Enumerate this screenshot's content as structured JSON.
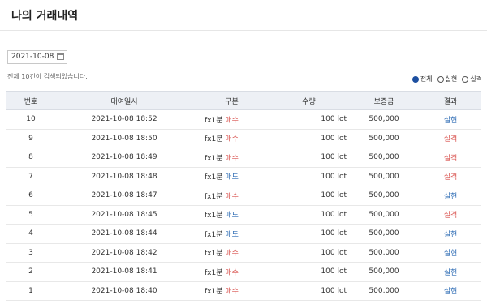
{
  "page": {
    "title": "나의 거래내역"
  },
  "search": {
    "date": "2021-10-08",
    "result_text": "전체 10건이 검색되었습니다."
  },
  "filters": [
    {
      "label": "전체",
      "selected": true
    },
    {
      "label": "실현",
      "selected": false
    },
    {
      "label": "실격",
      "selected": false
    }
  ],
  "table": {
    "headers": [
      "번호",
      "대여일시",
      "구분",
      "수량",
      "보증금",
      "결과"
    ],
    "rows": [
      {
        "no": "10",
        "datetime": "2021-10-08 18:52",
        "product": "fx1분",
        "side": "매수",
        "qty": "100 lot",
        "deposit": "500,000",
        "result": "실현"
      },
      {
        "no": "9",
        "datetime": "2021-10-08 18:50",
        "product": "fx1분",
        "side": "매수",
        "qty": "100 lot",
        "deposit": "500,000",
        "result": "실격"
      },
      {
        "no": "8",
        "datetime": "2021-10-08 18:49",
        "product": "fx1분",
        "side": "매수",
        "qty": "100 lot",
        "deposit": "500,000",
        "result": "실격"
      },
      {
        "no": "7",
        "datetime": "2021-10-08 18:48",
        "product": "fx1분",
        "side": "매도",
        "qty": "100 lot",
        "deposit": "500,000",
        "result": "실격"
      },
      {
        "no": "6",
        "datetime": "2021-10-08 18:47",
        "product": "fx1분",
        "side": "매수",
        "qty": "100 lot",
        "deposit": "500,000",
        "result": "실현"
      },
      {
        "no": "5",
        "datetime": "2021-10-08 18:45",
        "product": "fx1분",
        "side": "매도",
        "qty": "100 lot",
        "deposit": "500,000",
        "result": "실격"
      },
      {
        "no": "4",
        "datetime": "2021-10-08 18:44",
        "product": "fx1분",
        "side": "매도",
        "qty": "100 lot",
        "deposit": "500,000",
        "result": "실현"
      },
      {
        "no": "3",
        "datetime": "2021-10-08 18:42",
        "product": "fx1분",
        "side": "매수",
        "qty": "100 lot",
        "deposit": "500,000",
        "result": "실현"
      },
      {
        "no": "2",
        "datetime": "2021-10-08 18:41",
        "product": "fx1분",
        "side": "매수",
        "qty": "100 lot",
        "deposit": "500,000",
        "result": "실현"
      },
      {
        "no": "1",
        "datetime": "2021-10-08 18:40",
        "product": "fx1분",
        "side": "매수",
        "qty": "100 lot",
        "deposit": "500,000",
        "result": "실현"
      }
    ]
  },
  "colors": {
    "sell_side": "#d9534f",
    "buy_side": "#2f6db5",
    "result_win": "#2f6db5",
    "result_lose": "#d9534f",
    "radio_selected": "#1d4fa0"
  }
}
